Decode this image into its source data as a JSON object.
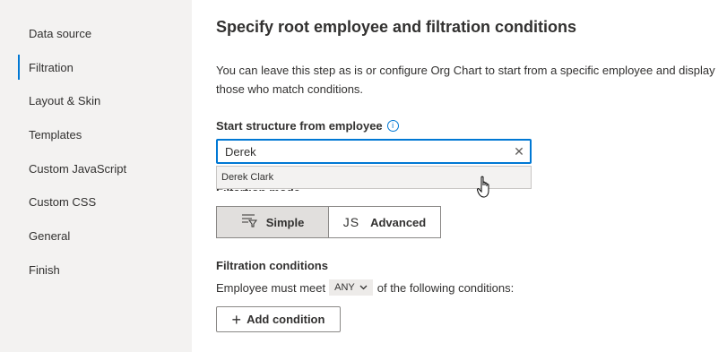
{
  "sidebar": {
    "items": [
      {
        "label": "Data source"
      },
      {
        "label": "Filtration"
      },
      {
        "label": "Layout & Skin"
      },
      {
        "label": "Templates"
      },
      {
        "label": "Custom JavaScript"
      },
      {
        "label": "Custom CSS"
      },
      {
        "label": "General"
      },
      {
        "label": "Finish"
      }
    ],
    "active": "Filtration"
  },
  "main": {
    "title": "Specify root employee and filtration conditions",
    "description": "You can leave this step as is or configure Org Chart to start from a specific employee and display those who match conditions.",
    "employee_field": {
      "label": "Start structure from employee",
      "value": "Derek",
      "suggestion": "Derek Clark"
    },
    "mode": {
      "label": "Filtartion mode",
      "simple_label": "Simple",
      "advanced_label": "Advanced",
      "advanced_icon_text": "JS",
      "selected": "Simple"
    },
    "conditions": {
      "label": "Filtration conditions",
      "prefix": "Employee must meet",
      "match_value": "ANY",
      "suffix": "of the following conditions:",
      "add_label": "Add condition"
    }
  },
  "colors": {
    "accent": "#0078d4",
    "sidebar_bg": "#f3f2f1",
    "selected_mode_bg": "#e1dfdd"
  }
}
